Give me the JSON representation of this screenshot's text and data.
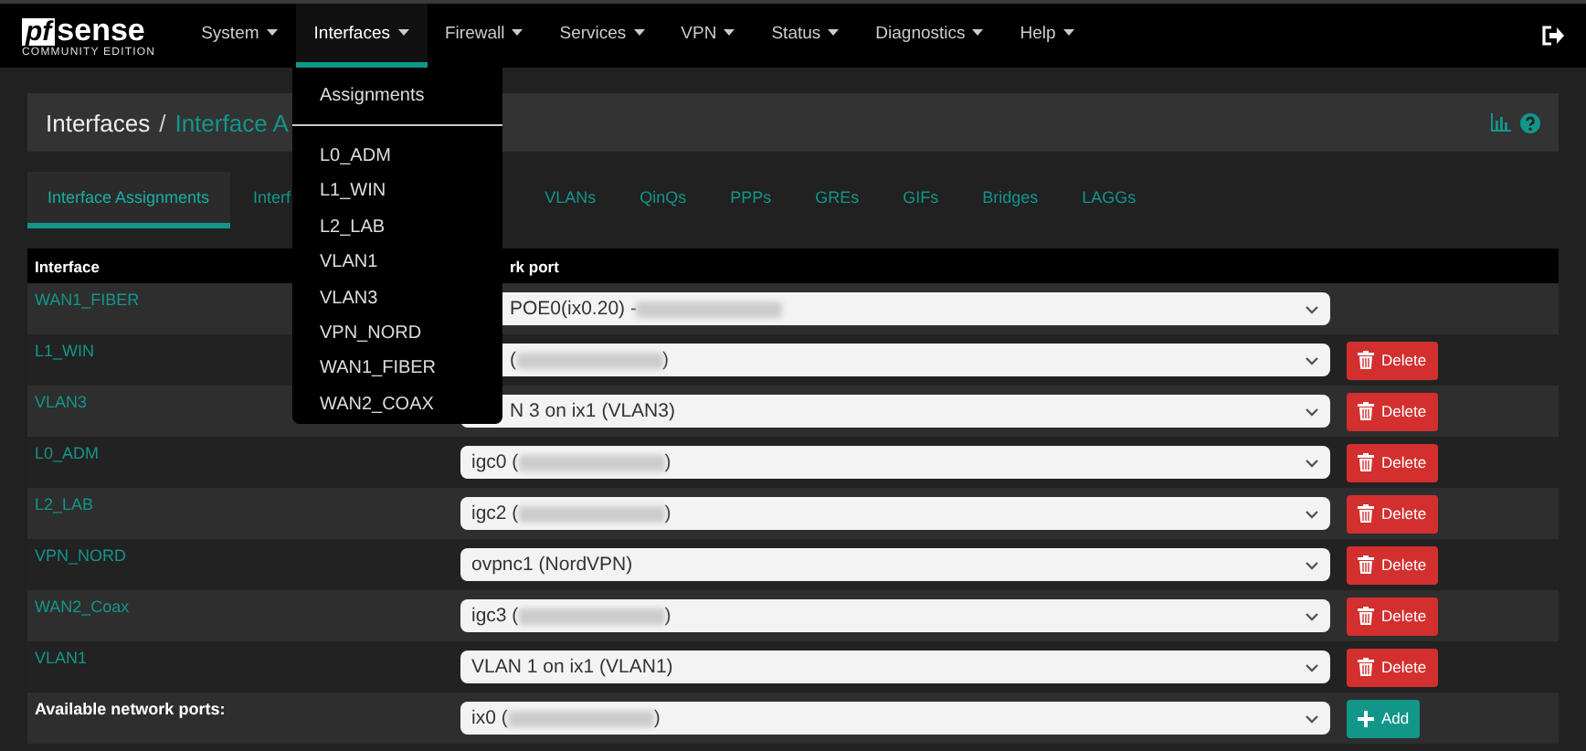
{
  "brand": {
    "logo": "pf",
    "logo_rest": "sense",
    "edition": "COMMUNITY EDITION"
  },
  "menu": [
    {
      "label": "System",
      "selected": false
    },
    {
      "label": "Interfaces",
      "selected": true
    },
    {
      "label": "Firewall",
      "selected": false
    },
    {
      "label": "Services",
      "selected": false
    },
    {
      "label": "VPN",
      "selected": false
    },
    {
      "label": "Status",
      "selected": false
    },
    {
      "label": "Diagnostics",
      "selected": false
    },
    {
      "label": "Help",
      "selected": false
    }
  ],
  "dropdown": {
    "header": "Assignments",
    "items": [
      "L0_ADM",
      "L1_WIN",
      "L2_LAB",
      "VLAN1",
      "VLAN3",
      "VPN_NORD",
      "WAN1_FIBER",
      "WAN2_COAX"
    ]
  },
  "breadcrumb": {
    "root": "Interfaces",
    "separator": "/",
    "current": "Interface A"
  },
  "tabs": [
    {
      "label": "Interface Assignments",
      "selected": true
    },
    {
      "label": "Interf",
      "selected": false
    },
    {
      "label": "VLANs",
      "selected": false
    },
    {
      "label": "QinQs",
      "selected": false
    },
    {
      "label": "PPPs",
      "selected": false
    },
    {
      "label": "GREs",
      "selected": false
    },
    {
      "label": "GIFs",
      "selected": false
    },
    {
      "label": "Bridges",
      "selected": false
    },
    {
      "label": "LAGGs",
      "selected": false
    }
  ],
  "table": {
    "columns": [
      "Interface",
      "rk port"
    ],
    "rows": [
      {
        "interface": "WAN1_FIBER",
        "port": "POE0(ix0.20) - ",
        "redacted": true,
        "suffix": ""
      },
      {
        "interface": "L1_WIN",
        "port": "(",
        "redacted": true,
        "suffix": ")",
        "delete_label": "Delete"
      },
      {
        "interface": "VLAN3",
        "port": "N 3 on ix1 (VLAN3)",
        "redacted": false,
        "suffix": "",
        "delete_label": "Delete"
      },
      {
        "interface": "L0_ADM",
        "port": "igc0 (",
        "redacted": true,
        "suffix": ")",
        "delete_label": "Delete"
      },
      {
        "interface": "L2_LAB",
        "port": "igc2 (",
        "redacted": true,
        "suffix": ")",
        "delete_label": "Delete"
      },
      {
        "interface": "VPN_NORD",
        "port": "ovpnc1 (NordVPN)",
        "redacted": false,
        "suffix": "",
        "delete_label": "Delete"
      },
      {
        "interface": "WAN2_Coax",
        "port": "igc3 (",
        "redacted": true,
        "suffix": ")",
        "delete_label": "Delete"
      },
      {
        "interface": "VLAN1",
        "port": "VLAN 1 on ix1 (VLAN1)",
        "redacted": false,
        "suffix": "",
        "delete_label": "Delete"
      }
    ],
    "available": {
      "label": "Available network ports:",
      "port": "ix0 (",
      "redacted": true,
      "suffix": ")",
      "button": "Add"
    }
  }
}
